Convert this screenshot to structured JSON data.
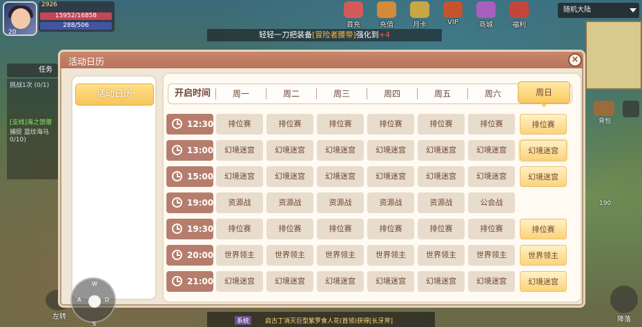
{
  "hud": {
    "gold": "2926",
    "hp": "15952/16858",
    "mp": "288/506",
    "level": "20"
  },
  "top_icons": [
    {
      "label": "首充"
    },
    {
      "label": "充值"
    },
    {
      "label": "月卡"
    },
    {
      "label": "VIP"
    },
    {
      "label": "商城"
    },
    {
      "label": "福利"
    }
  ],
  "server_select": "随机大陆",
  "notice": {
    "pre": "轻轻一刀把装备",
    "item": "[冒险者腰带]",
    "mid": "强化到",
    "plus": "+4"
  },
  "task_tab": "任务",
  "quests": {
    "line1": "挑战1次  (0/1)",
    "line2": "[支线]海之馈赠",
    "line3": "捕捉  蓝纹海马",
    "line4": "0/10)"
  },
  "right_side": {
    "bag": "背包",
    "landing": "降落",
    "coin": "190"
  },
  "left_button": "左转",
  "chat": {
    "tag": "系统",
    "text": "启古丁消灭巨型紫罗食人花(首领)获得[长牙斧]"
  },
  "joystick": {
    "w": "W",
    "a": "A",
    "s": "S",
    "d": "D"
  },
  "panel": {
    "title": "活动日历",
    "close": "×",
    "sidebar_items": [
      "活动日历"
    ]
  },
  "schedule": {
    "time_header": "开启时间",
    "days": [
      "周一",
      "周二",
      "周三",
      "周四",
      "周五",
      "周六",
      "周日"
    ],
    "rows": [
      {
        "time": "12:30",
        "events": [
          "排位赛",
          "排位赛",
          "排位赛",
          "排位赛",
          "排位赛",
          "排位赛",
          "排位赛"
        ]
      },
      {
        "time": "13:00",
        "events": [
          "幻境迷宫",
          "幻境迷宫",
          "幻境迷宫",
          "幻境迷宫",
          "幻境迷宫",
          "幻境迷宫",
          "幻境迷宫"
        ]
      },
      {
        "time": "15:00",
        "events": [
          "幻境迷宫",
          "幻境迷宫",
          "幻境迷宫",
          "幻境迷宫",
          "幻境迷宫",
          "幻境迷宫",
          "幻境迷宫"
        ]
      },
      {
        "time": "19:00",
        "events": [
          "资源战",
          "资源战",
          "资源战",
          "资源战",
          "资源战",
          "公会战",
          ""
        ]
      },
      {
        "time": "19:30",
        "events": [
          "排位赛",
          "排位赛",
          "排位赛",
          "排位赛",
          "排位赛",
          "排位赛",
          "排位赛"
        ]
      },
      {
        "time": "20:00",
        "events": [
          "世界领主",
          "世界领主",
          "世界领主",
          "世界领主",
          "世界领主",
          "世界领主",
          "世界领主"
        ]
      },
      {
        "time": "21:00",
        "events": [
          "幻境迷宫",
          "幻境迷宫",
          "幻境迷宫",
          "幻境迷宫",
          "幻境迷宫",
          "幻境迷宫",
          "幻境迷宫"
        ]
      }
    ],
    "active_day": "周日"
  },
  "colors": {
    "accent": "#f8cb62",
    "title_bar": "#b8735a",
    "time_cell": "#b67d6d",
    "event_cell": "#e8dccd"
  }
}
